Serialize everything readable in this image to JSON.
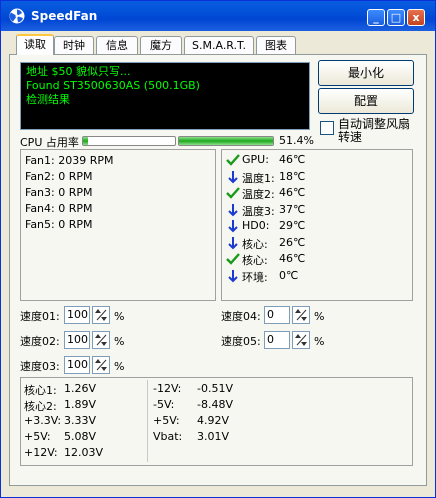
{
  "window": {
    "title": "SpeedFan",
    "minimize": "_",
    "maximize": "□",
    "close": "x"
  },
  "tabs": [
    "读取",
    "时钟",
    "信息",
    "魔方",
    "S.M.A.R.T.",
    "图表"
  ],
  "console": {
    "lines": [
      "地址 $50 貌似只写...",
      "Found ST3500630AS (500.1GB)",
      "检测结果"
    ]
  },
  "buttons": {
    "minimize": "最小化",
    "config": "配置"
  },
  "auto_fan": {
    "label": "自动调整风扇转速",
    "checked": false
  },
  "cpu": {
    "label": "CPU 占用率",
    "value": "51.4%",
    "bar1": 0.05,
    "bar2": 0.514
  },
  "fans": [
    "Fan1: 2039 RPM",
    "Fan2: 0 RPM",
    "Fan3: 0 RPM",
    "Fan4: 0 RPM",
    "Fan5: 0 RPM"
  ],
  "temps": [
    {
      "icon": "check-icon",
      "label": "GPU:",
      "value": "46℃"
    },
    {
      "icon": "down-arrow-icon",
      "label": "温度1:",
      "value": "18℃"
    },
    {
      "icon": "check-icon",
      "label": "温度2:",
      "value": "46℃"
    },
    {
      "icon": "down-arrow-icon",
      "label": "温度3:",
      "value": "37℃"
    },
    {
      "icon": "down-arrow-icon",
      "label": "HD0:",
      "value": "29℃"
    },
    {
      "icon": "down-arrow-icon",
      "label": "核心:",
      "value": "26℃"
    },
    {
      "icon": "check-icon",
      "label": "核心:",
      "value": "46℃"
    },
    {
      "icon": "down-arrow-icon",
      "label": "环境:",
      "value": "0℃"
    }
  ],
  "speeds": {
    "s01": {
      "label": "速度01:",
      "value": "100",
      "unit": "%"
    },
    "s02": {
      "label": "速度02:",
      "value": "100",
      "unit": "%"
    },
    "s03": {
      "label": "速度03:",
      "value": "100",
      "unit": "%"
    },
    "s04": {
      "label": "速度04:",
      "value": "0",
      "unit": "%"
    },
    "s05": {
      "label": "速度05:",
      "value": "0",
      "unit": "%"
    }
  },
  "voltages_left": [
    {
      "label": "核心1:",
      "value": "1.26V"
    },
    {
      "label": "核心2:",
      "value": "1.89V"
    },
    {
      "label": "+3.3V:",
      "value": "3.33V"
    },
    {
      "label": "+5V:",
      "value": "5.08V"
    },
    {
      "label": "+12V:",
      "value": "12.03V"
    }
  ],
  "voltages_right": [
    {
      "label": "-12V:",
      "value": "-0.51V"
    },
    {
      "label": "-5V:",
      "value": "-8.48V"
    },
    {
      "label": "+5V:",
      "value": "4.92V"
    },
    {
      "label": "Vbat:",
      "value": "3.01V"
    }
  ]
}
